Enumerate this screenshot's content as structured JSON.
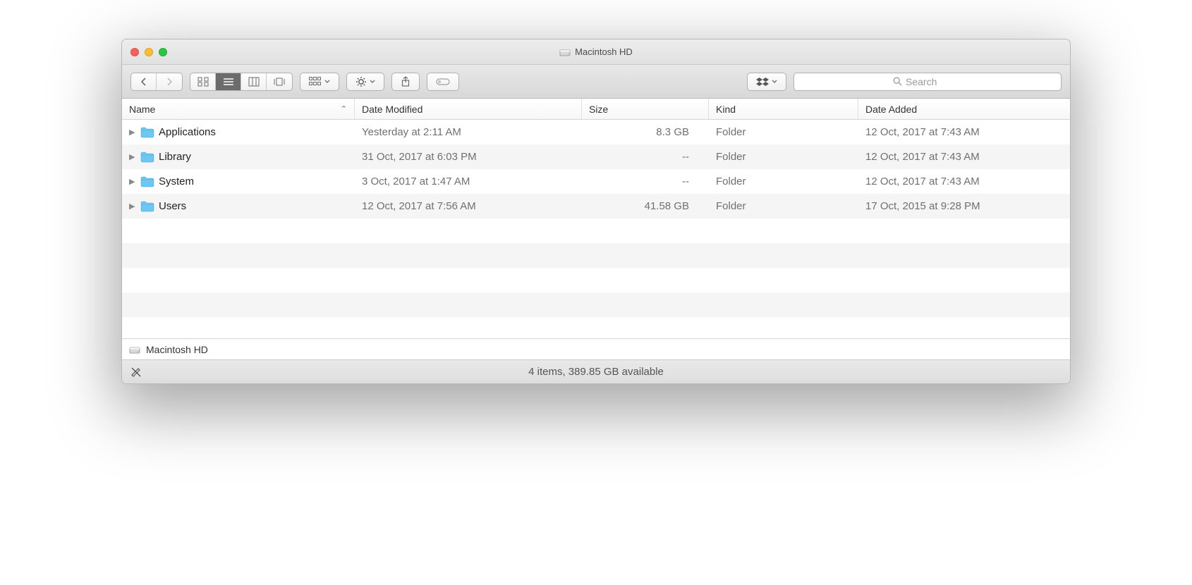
{
  "title": "Macintosh HD",
  "search": {
    "placeholder": "Search"
  },
  "columns": {
    "name": "Name",
    "date": "Date Modified",
    "size": "Size",
    "kind": "Kind",
    "added": "Date Added"
  },
  "rows": [
    {
      "name": "Applications",
      "date": "Yesterday at 2:11 AM",
      "size": "8.3 GB",
      "kind": "Folder",
      "added": "12 Oct, 2017 at 7:43 AM",
      "icon": "apps"
    },
    {
      "name": "Library",
      "date": "31 Oct, 2017 at 6:03 PM",
      "size": "--",
      "kind": "Folder",
      "added": "12 Oct, 2017 at 7:43 AM",
      "icon": "library"
    },
    {
      "name": "System",
      "date": "3 Oct, 2017 at 1:47 AM",
      "size": "--",
      "kind": "Folder",
      "added": "12 Oct, 2017 at 7:43 AM",
      "icon": "system"
    },
    {
      "name": "Users",
      "date": "12 Oct, 2017 at 7:56 AM",
      "size": "41.58 GB",
      "kind": "Folder",
      "added": "17 Oct, 2015 at 9:28 PM",
      "icon": "users"
    }
  ],
  "path": {
    "label": "Macintosh HD"
  },
  "status": "4 items, 389.85 GB available"
}
